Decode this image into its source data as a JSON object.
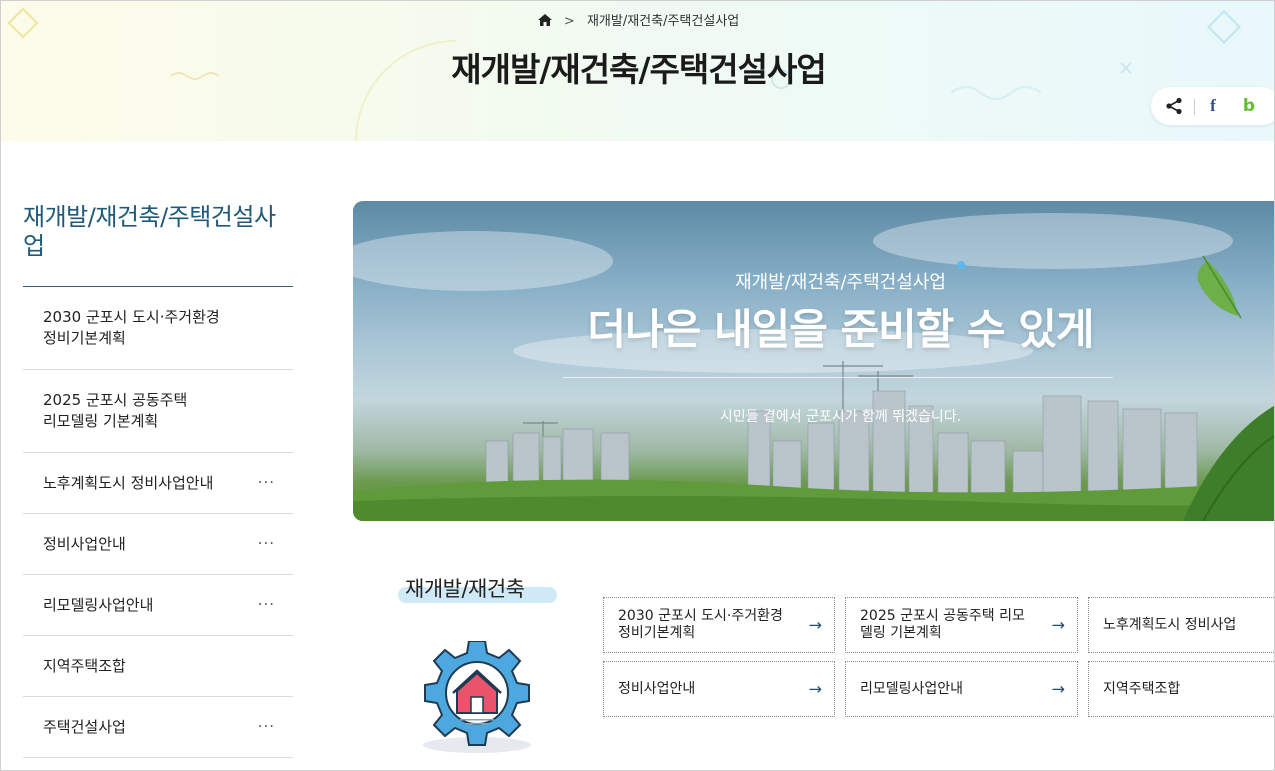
{
  "breadcrumb": {
    "current": "재개발/재건축/주택건설사업"
  },
  "page_title": "재개발/재건축/주택건설사업",
  "share": {
    "facebook": "f",
    "band": "b"
  },
  "sidebar": {
    "title": "재개발/재건축/주택건설사업",
    "items": [
      {
        "line1": "2030 군포시 도시·주거환경",
        "line2": "정비기본계획",
        "more": ""
      },
      {
        "line1": "2025 군포시 공동주택",
        "line2": "리모델링 기본계획",
        "more": ""
      },
      {
        "line1": "노후계획도시 정비사업안내",
        "line2": "",
        "more": "···"
      },
      {
        "line1": "정비사업안내",
        "line2": "",
        "more": "···"
      },
      {
        "line1": "리모델링사업안내",
        "line2": "",
        "more": "···"
      },
      {
        "line1": "지역주택조합",
        "line2": "",
        "more": ""
      },
      {
        "line1": "주택건설사업",
        "line2": "",
        "more": "···"
      }
    ]
  },
  "banner": {
    "subtitle": "재개발/재건축/주택건설사업",
    "headline": "더나은 내일을 준비할 수 있게",
    "description": "시민들 곁에서 군포시가 함께 뛰겠습니다."
  },
  "section": {
    "title": "재개발/재건축",
    "links": [
      {
        "line1": "2030 군포시 도시·주거환경",
        "line2": "정비기본계획",
        "arrow": "→"
      },
      {
        "line1": "2025 군포시 공동주택 리모",
        "line2": "델링 기본계획",
        "arrow": "→"
      },
      {
        "line1": "노후계획도시 정비사업",
        "line2": "",
        "arrow": ""
      },
      {
        "line1": "정비사업안내",
        "line2": "",
        "arrow": "→"
      },
      {
        "line1": "리모델링사업안내",
        "line2": "",
        "arrow": "→"
      },
      {
        "line1": "지역주택조합",
        "line2": "",
        "arrow": ""
      }
    ]
  },
  "colors": {
    "accent": "#1f5a7a",
    "gear": "#4ea8e0",
    "house": "#e9546b"
  },
  "icons": [
    "home-icon",
    "share-icon",
    "facebook-icon",
    "band-icon",
    "more-icon",
    "arrow-right-icon",
    "gear-house-icon"
  ]
}
